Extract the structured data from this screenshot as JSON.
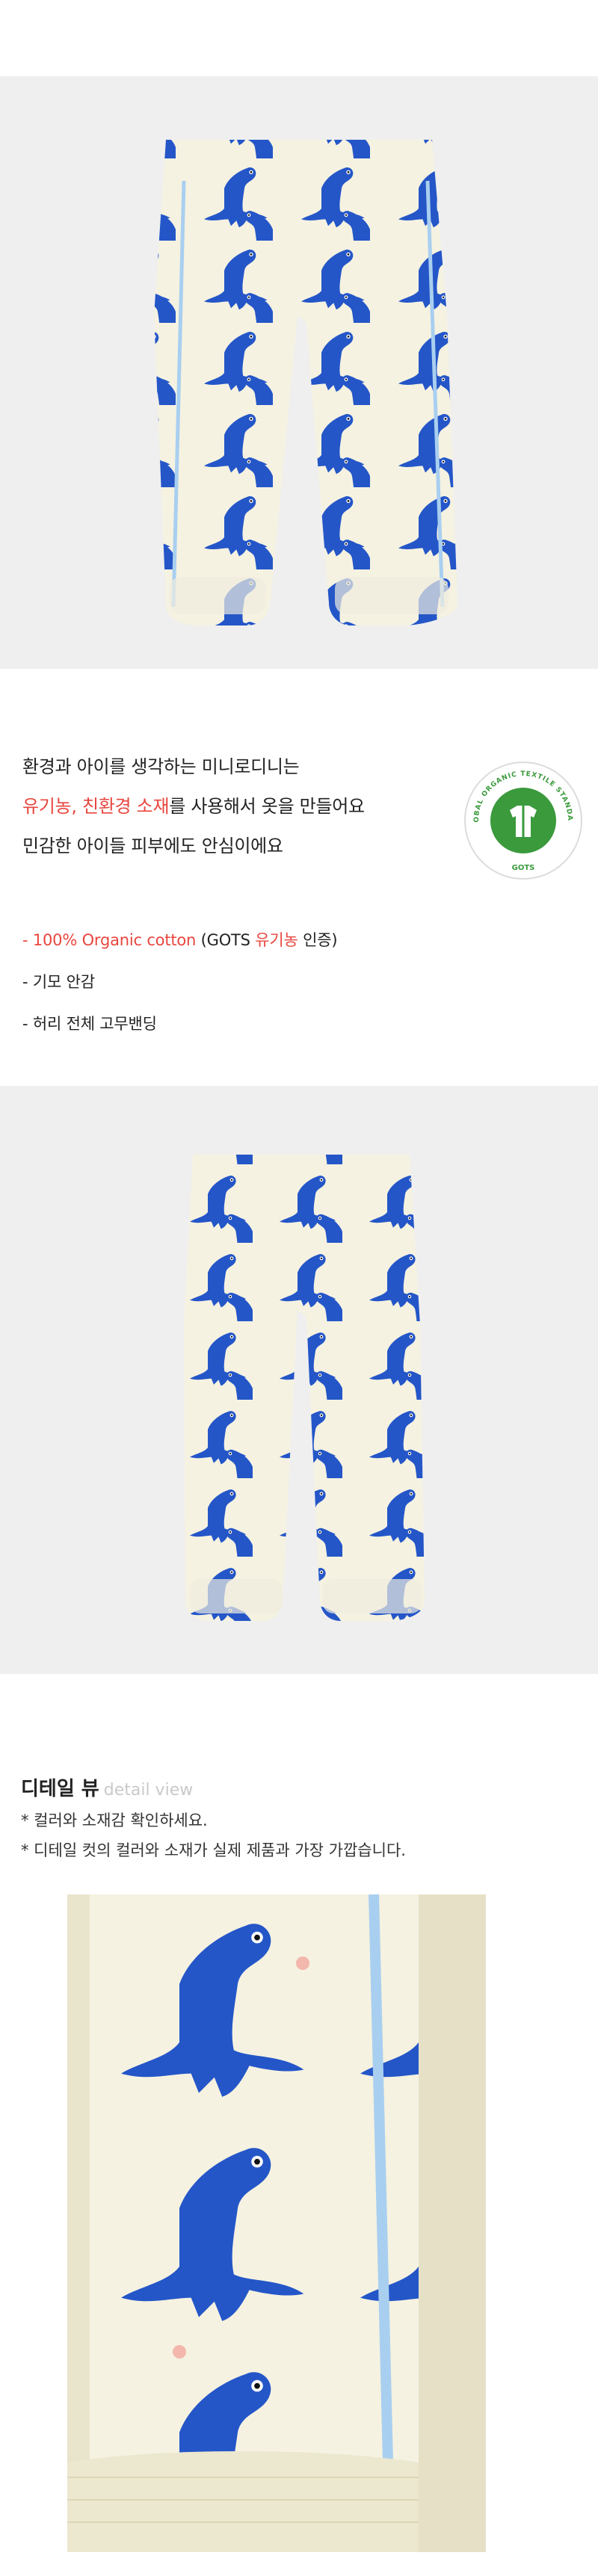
{
  "intro": {
    "line1": "환경과 아이를 생각하는 미니로디니는",
    "line2_accent": "유기농, 친환경 소재",
    "line2_rest": "를 사용해서 옷을 만들어요",
    "line3": "민감한 아이들 피부에도 안심이에요"
  },
  "badge": {
    "top_text": "GLOBAL ORGANIC TEXTILE STANDARD",
    "bottom_text": "GOTS",
    "icon": "organic-shirt-icon"
  },
  "features": [
    {
      "accent": "- 100% Organic cotton",
      "mid": " (GOTS ",
      "accent2": "유기농",
      "tail": " 인증)"
    },
    {
      "text": "- 기모 안감"
    },
    {
      "text": "- 허리 전체 고무밴딩"
    }
  ],
  "detail": {
    "title": "디테일 뷰",
    "subtitle": "detail view",
    "notes": [
      "* 컬러와 소재감 확인하세요.",
      "* 디테일 컷의 컬러와 소재가 실제 제품과 가장 가깝습니다."
    ]
  },
  "colors": {
    "accent": "#e8463e",
    "fabric": "#f5f2e1",
    "dino_blue": "#2456c8",
    "piping": "#a9cff0",
    "gots_green": "#3a9a3c"
  }
}
